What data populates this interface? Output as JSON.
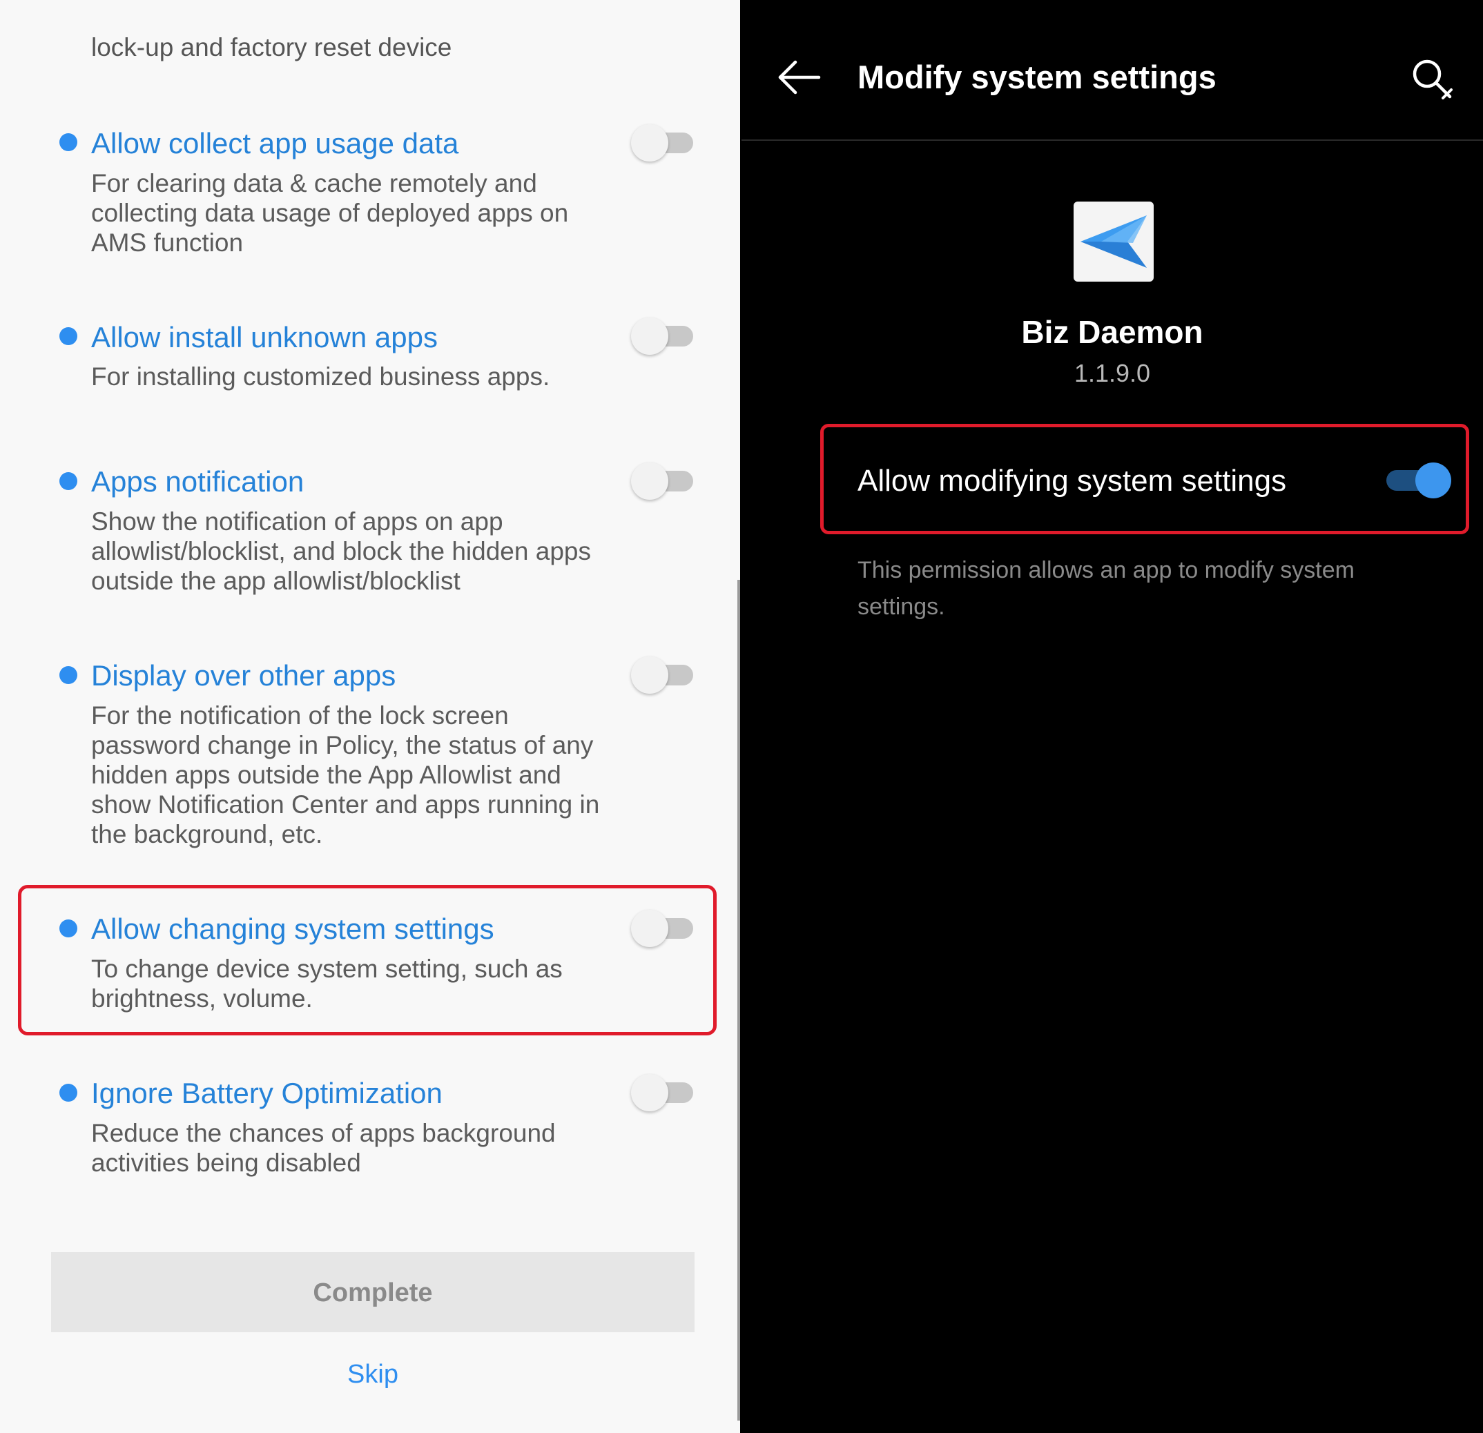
{
  "left_panel": {
    "top_description": "lock-up and factory reset device",
    "permissions": [
      {
        "title": "Allow collect app usage data",
        "description": "For clearing data & cache remotely and collecting data usage of deployed apps on AMS function",
        "enabled": false
      },
      {
        "title": "Allow install unknown apps",
        "description": "For installing customized business apps.",
        "enabled": false
      },
      {
        "title": "Apps notification",
        "description": "Show the notification of apps on app allowlist/blocklist, and block the hidden apps outside the app allowlist/blocklist",
        "enabled": false
      },
      {
        "title": "Display over other apps",
        "description": "For the notification of the lock screen password change in Policy, the status of any hidden apps outside the App Allowlist and show Notification Center and apps running in the background, etc.",
        "enabled": false
      },
      {
        "title": "Allow changing system settings",
        "description": "To change device system setting, such as brightness, volume.",
        "enabled": false,
        "highlighted": true
      },
      {
        "title": "Ignore Battery Optimization",
        "description": "Reduce the chances of apps background activities being disabled",
        "enabled": false
      }
    ],
    "complete_label": "Complete",
    "skip_label": "Skip"
  },
  "right_panel": {
    "title": "Modify system settings",
    "back_icon": "arrow-left-icon",
    "search_icon": "search-icon",
    "app": {
      "name": "Biz Daemon",
      "version": "1.1.9.0",
      "icon": "paper-plane-icon"
    },
    "toggle": {
      "label": "Allow modifying system settings",
      "enabled": true
    },
    "permission_description": "This permission allows an app to modify system settings."
  },
  "colors": {
    "accent_blue": "#2e8ef0",
    "title_blue": "#2582d8",
    "highlight_red": "#e01b2b",
    "dark_background": "#000000",
    "light_background": "#f8f8f8"
  }
}
